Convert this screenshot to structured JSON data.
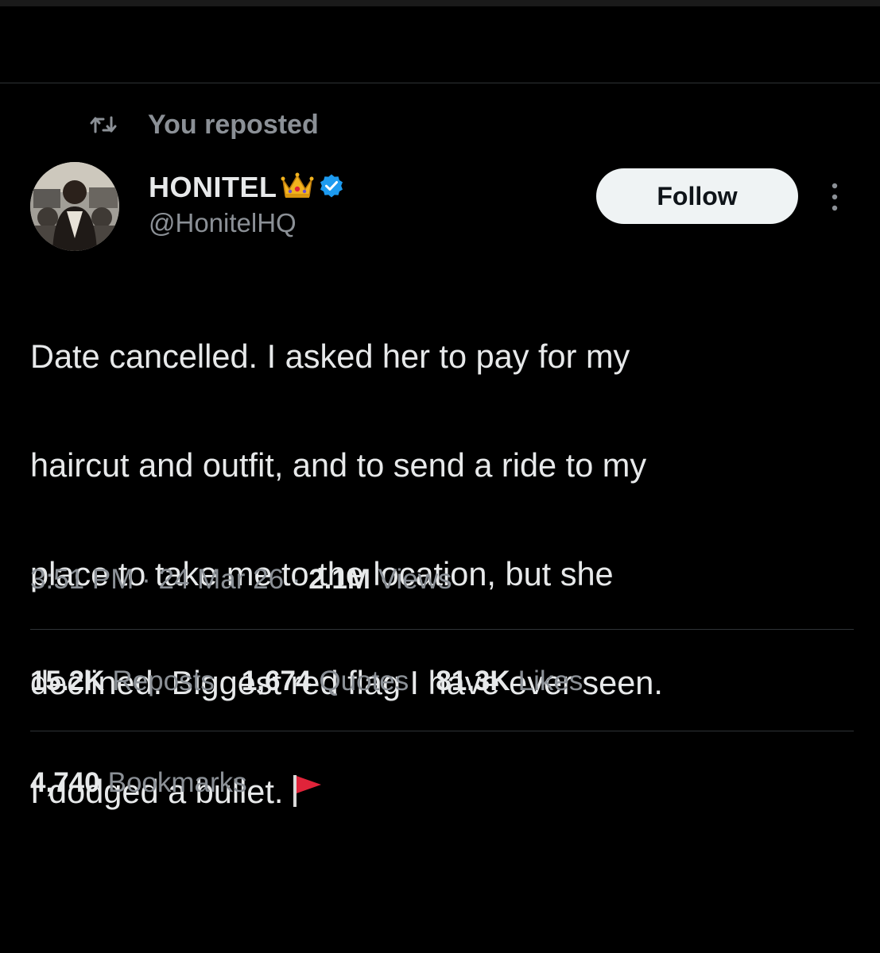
{
  "repost_banner": {
    "label": "You reposted",
    "icon": "repost-icon"
  },
  "author": {
    "display_name": "HONITEL",
    "name_emoji": "crown-icon",
    "verified_icon": "verified-badge-icon",
    "handle": "@HonitelHQ",
    "avatar": "avatar"
  },
  "follow_button": {
    "label": "Follow"
  },
  "more_menu": {
    "icon": "more-vertical-icon"
  },
  "tweet": {
    "lines": [
      "Date cancelled. I asked her to pay for my",
      "haircut and outfit, and to send a ride to my",
      "place to take me to the location, but she",
      "declined. Biggest red flag I have ever seen.",
      "I dodged a bullet."
    ],
    "emoji": "red-flag-icon"
  },
  "meta": {
    "time": "3:51 PM",
    "separator": "·",
    "date": "24 Mar 26",
    "views_count": "2.1M",
    "views_label": "Views"
  },
  "stats": {
    "reposts": {
      "count": "15.2K",
      "label": "Reposts"
    },
    "quotes": {
      "count": "1,674",
      "label": "Quotes"
    },
    "likes": {
      "count": "81.3K",
      "label": "Likes"
    },
    "bookmarks": {
      "count": "4,740",
      "label": "Bookmarks"
    }
  },
  "colors": {
    "background": "#000000",
    "text_primary": "#e7e9ea",
    "text_secondary": "#8b9096",
    "divider": "#2f3336",
    "verified": "#1d9bf0",
    "follow_bg": "#eff3f4",
    "flag_red": "#e0243a"
  }
}
